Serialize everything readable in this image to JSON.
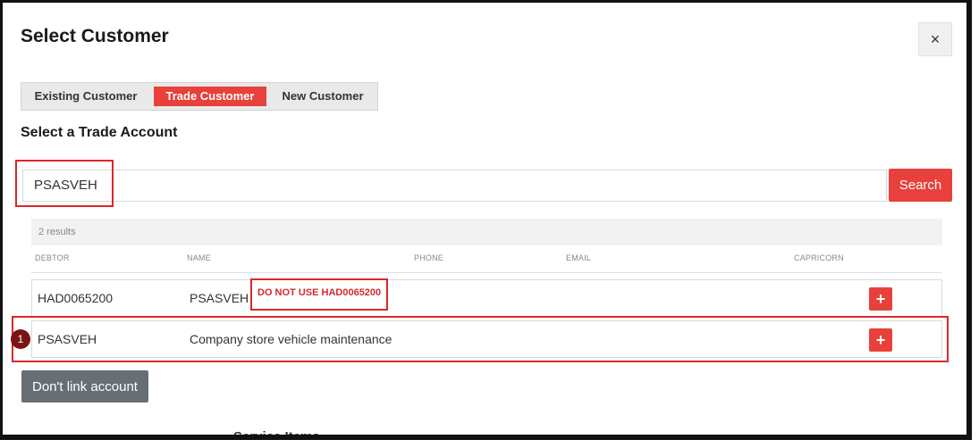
{
  "modal": {
    "title": "Select Customer",
    "close_label": "×"
  },
  "tabs": [
    {
      "label": "Existing Customer",
      "active": false
    },
    {
      "label": "Trade Customer",
      "active": true
    },
    {
      "label": "New Customer",
      "active": false
    }
  ],
  "section_title": "Select a Trade Account",
  "search": {
    "value": "PSASVEH",
    "button_label": "Search"
  },
  "results": {
    "count_label": "2 results",
    "columns": [
      "DEBTOR",
      "NAME",
      "PHONE",
      "EMAIL",
      "CAPRICORN"
    ],
    "rows": [
      {
        "debtor": "HAD0065200",
        "name": "PSASVEH",
        "add_label": "+"
      },
      {
        "debtor": "PSASVEH",
        "name": "Company store vehicle maintenance",
        "add_label": "+"
      }
    ]
  },
  "annotation": {
    "note": "DO NOT USE HAD0065200",
    "step_badge": "1"
  },
  "footer": {
    "dont_link_label": "Don't link account"
  },
  "background": {
    "peek_text": "Service Items"
  },
  "colors": {
    "accent": "#e8403b",
    "highlight": "#d9282b",
    "secondary_button": "#676f75",
    "badge": "#7a1414"
  }
}
